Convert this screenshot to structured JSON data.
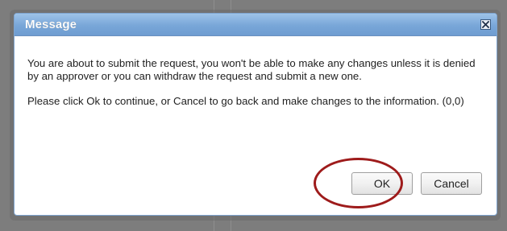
{
  "dialog": {
    "title": "Message",
    "close_icon": "close-icon",
    "message_1": "You are about to submit the request, you won't be able to make any changes unless it is denied by an approver or you can withdraw the request and submit a new one.",
    "message_2": "Please click Ok to continue, or Cancel to go back and make changes to the information. (0,0)",
    "ok_label": "OK",
    "cancel_label": "Cancel"
  },
  "colors": {
    "titlebar": "#78a6d8",
    "highlight": "#9e1b1b",
    "overlay": "#7d7d7d"
  }
}
